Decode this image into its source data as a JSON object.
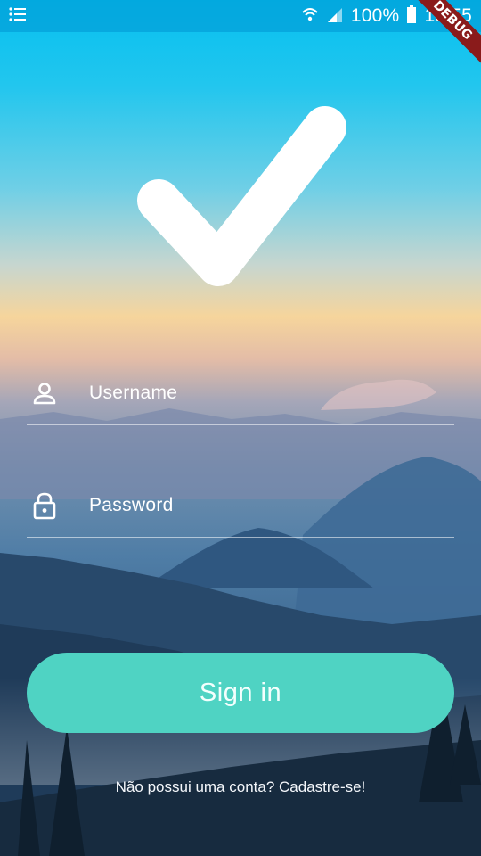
{
  "status_bar": {
    "menu_icon": "list-icon",
    "wifi_icon": "wifi-icon",
    "signal_icon": "signal-icon",
    "battery_percent": "100%",
    "battery_icon": "battery-icon",
    "time": "15:55",
    "debug_label": "DEBUG"
  },
  "logo": {
    "icon": "checkmark-icon"
  },
  "form": {
    "username_placeholder": "Username",
    "username_icon": "person-icon",
    "password_placeholder": "Password",
    "password_icon": "lock-icon",
    "signin_label": "Sign in",
    "signup_text": "Não possui uma conta? Cadastre-se!"
  },
  "colors": {
    "accent": "#4fd3c3",
    "sky_top": "#06c0f0",
    "debug_ribbon": "#8a1b1b"
  }
}
